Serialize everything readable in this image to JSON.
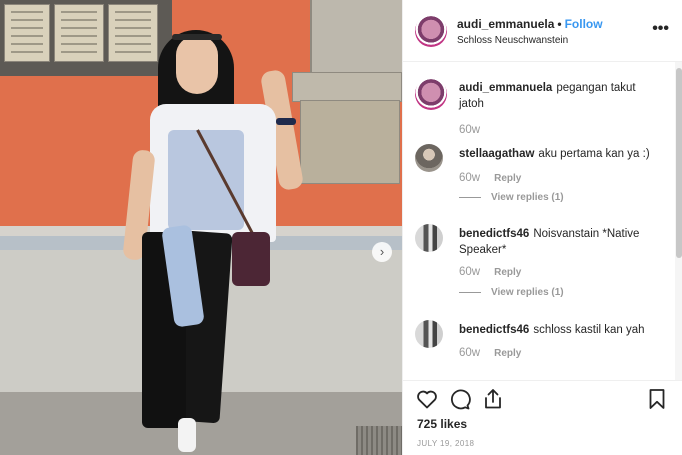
{
  "post": {
    "username": "audi_emmanuela",
    "separator": "•",
    "follow_label": "Follow",
    "location": "Schloss Neuschwanstein",
    "more_label": "•••",
    "next_label": "›"
  },
  "comments": [
    {
      "username": "audi_emmanuela",
      "text": "pegangan takut jatoh",
      "time": "60w",
      "reply_label": "",
      "view_replies": ""
    },
    {
      "username": "stellaagathaw",
      "text": "aku pertama kan ya :)",
      "time": "60w",
      "reply_label": "Reply",
      "view_replies": "View replies (1)"
    },
    {
      "username": "benedictfs46",
      "text": "Noisvanstain *Native Speaker*",
      "time": "60w",
      "reply_label": "Reply",
      "view_replies": "View replies (1)"
    },
    {
      "username": "benedictfs46",
      "text": "schloss kastil kan yah",
      "time": "60w",
      "reply_label": "Reply",
      "view_replies": ""
    }
  ],
  "footer": {
    "likes": "725 likes",
    "date": "JULY 19, 2018"
  },
  "colors": {
    "link_blue": "#3897f0",
    "muted": "#999999",
    "text": "#262626"
  },
  "icons": [
    "heart-icon",
    "comment-icon",
    "share-icon",
    "bookmark-icon",
    "more-options-icon",
    "next-arrow-icon"
  ]
}
